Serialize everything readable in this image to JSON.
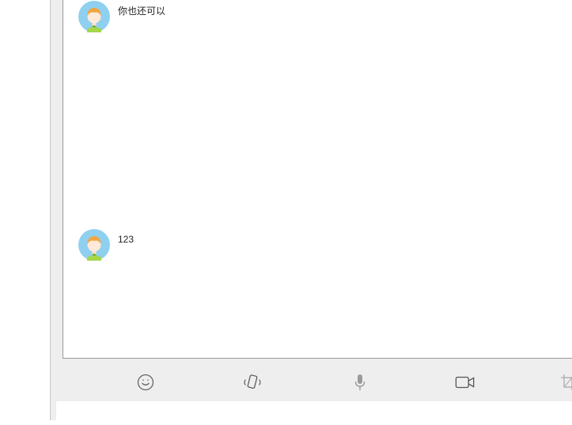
{
  "messages": [
    {
      "text": "你也还可以",
      "avatar": "cartoon-girl-avatar"
    },
    {
      "text": "123",
      "avatar": "cartoon-girl-avatar"
    }
  ],
  "toolbar": {
    "buttons": [
      {
        "icon": "emoji-smile-icon"
      },
      {
        "icon": "shake-window-icon"
      },
      {
        "icon": "microphone-icon"
      },
      {
        "icon": "video-camera-icon"
      },
      {
        "icon": "screenshot-crop-icon"
      }
    ]
  },
  "input": {
    "value": ""
  },
  "colors": {
    "toolbar_bg": "#eeeeee",
    "icon": "#666666",
    "avatar_bg": "#8fd0f0",
    "hair": "#f0a640",
    "collar": "#a6d64b"
  }
}
